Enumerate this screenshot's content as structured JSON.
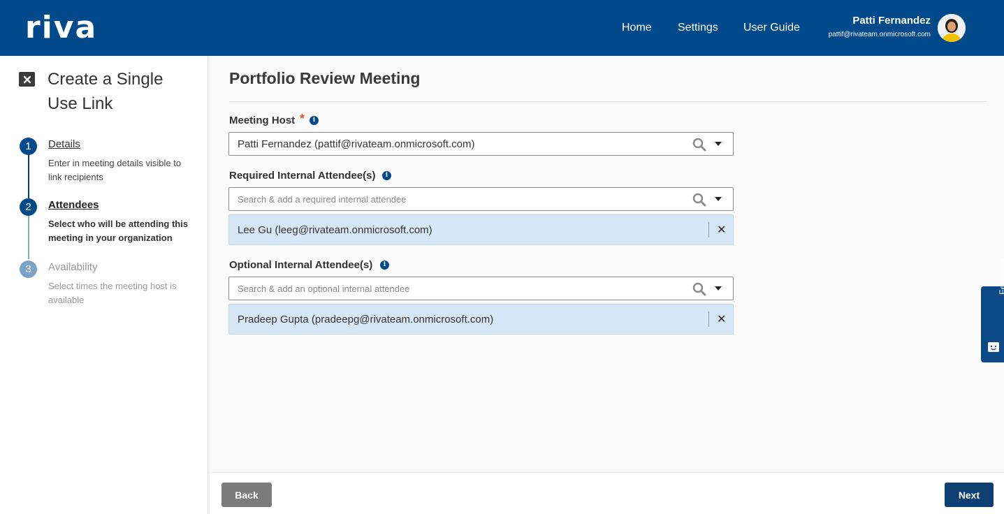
{
  "header": {
    "logo_text": "riva",
    "nav": [
      "Home",
      "Settings",
      "User Guide"
    ],
    "user_name": "Patti Fernandez",
    "user_email": "pattif@rivateam.onmicrosoft.com"
  },
  "sidebar": {
    "title": "Create a Single Use Link",
    "steps": [
      {
        "number": "1",
        "title": "Details",
        "description": "Enter in meeting details visible to link recipients"
      },
      {
        "number": "2",
        "title": "Attendees",
        "description": "Select who will be attending this meeting in your organization"
      },
      {
        "number": "3",
        "title": "Availability",
        "description": "Select times the meeting host is available"
      }
    ]
  },
  "main": {
    "title": "Portfolio Review Meeting",
    "host": {
      "label": "Meeting Host",
      "required_mark": "*",
      "value": "Patti Fernandez (pattif@rivateam.onmicrosoft.com)"
    },
    "required_attendees": {
      "label": "Required Internal Attendee(s)",
      "placeholder": "Search & add a required internal attendee",
      "selected": [
        "Lee Gu (leeg@rivateam.onmicrosoft.com)"
      ]
    },
    "optional_attendees": {
      "label": "Optional Internal Attendee(s)",
      "placeholder": "Search & add an optional internal attendee",
      "selected": [
        "Pradeep Gupta (pradeepg@rivateam.onmicrosoft.com)"
      ]
    }
  },
  "footer": {
    "back_label": "Back",
    "next_label": "Next"
  },
  "feedback": {
    "label": "Feedback"
  },
  "colors": {
    "brand": "#004a8b",
    "chip_bg": "#d6e8f7",
    "required_star": "#e0533b",
    "back_button": "#7b7b7b"
  }
}
